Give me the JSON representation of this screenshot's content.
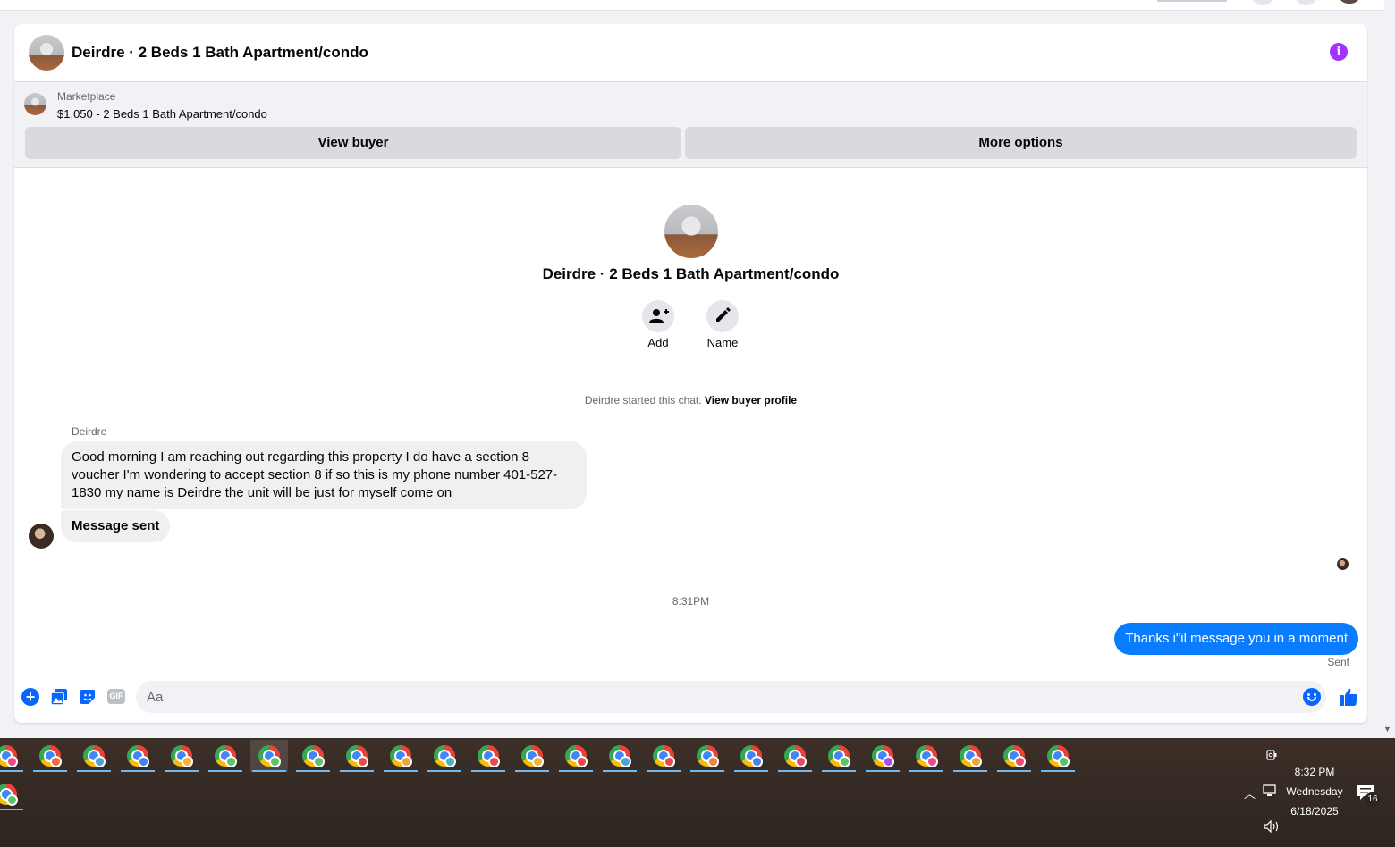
{
  "conversation": {
    "title": "Deirdre · 2 Beds 1 Bath Apartment/condo",
    "info_icon": "info-icon"
  },
  "marketplace": {
    "label": "Marketplace",
    "listing": "$1,050 - 2 Beds 1 Bath Apartment/condo",
    "view_buyer": "View buyer",
    "more_options": "More options"
  },
  "intro": {
    "title": "Deirdre · 2 Beds 1 Bath Apartment/condo",
    "add_label": "Add",
    "name_label": "Name",
    "started_text": "Deirdre started this chat.",
    "view_profile": "View buyer profile"
  },
  "messages": {
    "sender": "Deirdre",
    "incoming_1": "Good morning I am reaching out regarding this property I do have a section 8 voucher I'm wondering to accept section 8 if so this is my phone number 401-527-1830 my name is Deirdre the unit will be just for myself come on",
    "incoming_2": "Message sent",
    "timestamp": "8:31PM",
    "outgoing_1": "Thanks i\"il message you in a moment",
    "status": "Sent"
  },
  "composer": {
    "placeholder": "Aa",
    "gif_label": "GIF"
  },
  "taskbar": {
    "badge_colors": [
      "#e94b8a",
      "#f06c3a",
      "#4aa3df",
      "#4a7ff0",
      "#f0b23a",
      "#5cc26b",
      "#5cc26b",
      "#5cc26b",
      "#e94b4b",
      "#f0a53a",
      "#4ab0c8",
      "#e94b4b",
      "#f0b23a",
      "#e94b4b",
      "#4aa3df",
      "#e94b4b",
      "#f0843a",
      "#4a7ff0",
      "#e94b6a",
      "#5cc26b",
      "#b04ae9",
      "#e94b8a",
      "#f0a53a",
      "#e94b6a",
      "#5cc26b",
      "#5cc26b"
    ],
    "time": "8:32 PM",
    "day": "Wednesday",
    "date": "6/18/2025",
    "notifications": "16"
  },
  "colors": {
    "accent": "#0866ff",
    "outgoing_bubble": "#0a7cff",
    "info": "#a033ff"
  }
}
